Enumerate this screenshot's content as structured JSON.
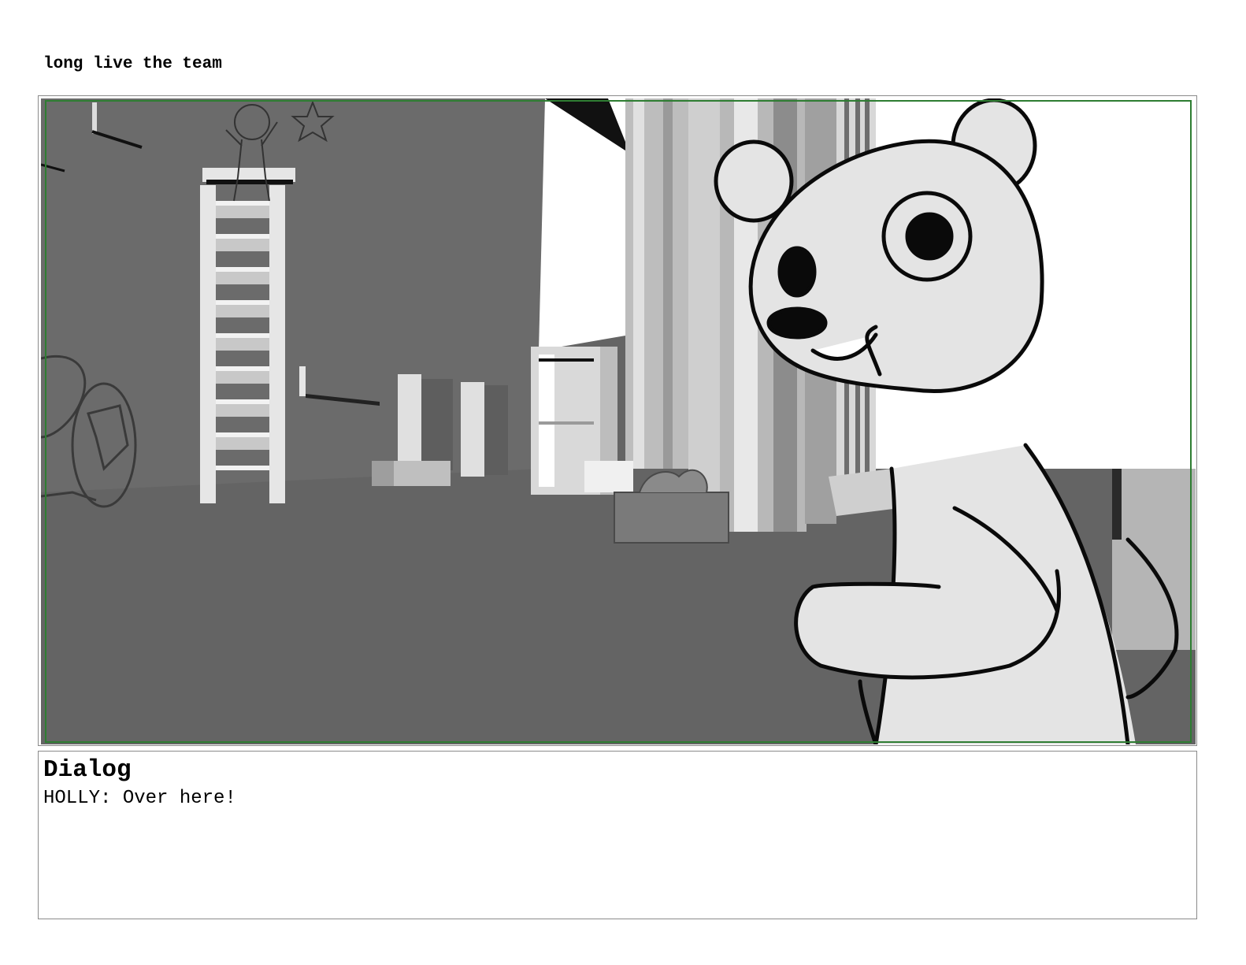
{
  "page": {
    "title": "long live the team"
  },
  "panel": {
    "image_description_icon": "storyboard-sketch-image",
    "colors": {
      "safe_area_border": "#2e7d32",
      "floor": "#646464",
      "wall": "#6a6a6a",
      "character_fill": "#e4e4e4"
    }
  },
  "dialog": {
    "heading": "Dialog",
    "line": "HOLLY: Over here!"
  }
}
